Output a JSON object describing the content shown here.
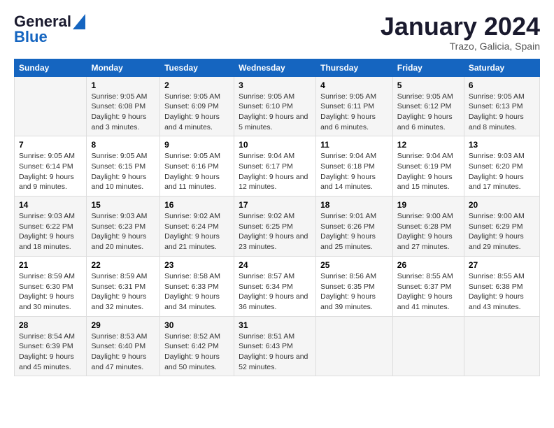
{
  "logo": {
    "line1": "General",
    "line2": "Blue"
  },
  "title": "January 2024",
  "subtitle": "Trazo, Galicia, Spain",
  "days_of_week": [
    "Sunday",
    "Monday",
    "Tuesday",
    "Wednesday",
    "Thursday",
    "Friday",
    "Saturday"
  ],
  "weeks": [
    [
      {
        "day": "",
        "sunrise": "",
        "sunset": "",
        "daylight": ""
      },
      {
        "day": "1",
        "sunrise": "9:05 AM",
        "sunset": "6:08 PM",
        "daylight": "9 hours and 3 minutes."
      },
      {
        "day": "2",
        "sunrise": "9:05 AM",
        "sunset": "6:09 PM",
        "daylight": "9 hours and 4 minutes."
      },
      {
        "day": "3",
        "sunrise": "9:05 AM",
        "sunset": "6:10 PM",
        "daylight": "9 hours and 5 minutes."
      },
      {
        "day": "4",
        "sunrise": "9:05 AM",
        "sunset": "6:11 PM",
        "daylight": "9 hours and 6 minutes."
      },
      {
        "day": "5",
        "sunrise": "9:05 AM",
        "sunset": "6:12 PM",
        "daylight": "9 hours and 6 minutes."
      },
      {
        "day": "6",
        "sunrise": "9:05 AM",
        "sunset": "6:13 PM",
        "daylight": "9 hours and 8 minutes."
      }
    ],
    [
      {
        "day": "7",
        "sunrise": "9:05 AM",
        "sunset": "6:14 PM",
        "daylight": "9 hours and 9 minutes."
      },
      {
        "day": "8",
        "sunrise": "9:05 AM",
        "sunset": "6:15 PM",
        "daylight": "9 hours and 10 minutes."
      },
      {
        "day": "9",
        "sunrise": "9:05 AM",
        "sunset": "6:16 PM",
        "daylight": "9 hours and 11 minutes."
      },
      {
        "day": "10",
        "sunrise": "9:04 AM",
        "sunset": "6:17 PM",
        "daylight": "9 hours and 12 minutes."
      },
      {
        "day": "11",
        "sunrise": "9:04 AM",
        "sunset": "6:18 PM",
        "daylight": "9 hours and 14 minutes."
      },
      {
        "day": "12",
        "sunrise": "9:04 AM",
        "sunset": "6:19 PM",
        "daylight": "9 hours and 15 minutes."
      },
      {
        "day": "13",
        "sunrise": "9:03 AM",
        "sunset": "6:20 PM",
        "daylight": "9 hours and 17 minutes."
      }
    ],
    [
      {
        "day": "14",
        "sunrise": "9:03 AM",
        "sunset": "6:22 PM",
        "daylight": "9 hours and 18 minutes."
      },
      {
        "day": "15",
        "sunrise": "9:03 AM",
        "sunset": "6:23 PM",
        "daylight": "9 hours and 20 minutes."
      },
      {
        "day": "16",
        "sunrise": "9:02 AM",
        "sunset": "6:24 PM",
        "daylight": "9 hours and 21 minutes."
      },
      {
        "day": "17",
        "sunrise": "9:02 AM",
        "sunset": "6:25 PM",
        "daylight": "9 hours and 23 minutes."
      },
      {
        "day": "18",
        "sunrise": "9:01 AM",
        "sunset": "6:26 PM",
        "daylight": "9 hours and 25 minutes."
      },
      {
        "day": "19",
        "sunrise": "9:00 AM",
        "sunset": "6:28 PM",
        "daylight": "9 hours and 27 minutes."
      },
      {
        "day": "20",
        "sunrise": "9:00 AM",
        "sunset": "6:29 PM",
        "daylight": "9 hours and 29 minutes."
      }
    ],
    [
      {
        "day": "21",
        "sunrise": "8:59 AM",
        "sunset": "6:30 PM",
        "daylight": "9 hours and 30 minutes."
      },
      {
        "day": "22",
        "sunrise": "8:59 AM",
        "sunset": "6:31 PM",
        "daylight": "9 hours and 32 minutes."
      },
      {
        "day": "23",
        "sunrise": "8:58 AM",
        "sunset": "6:33 PM",
        "daylight": "9 hours and 34 minutes."
      },
      {
        "day": "24",
        "sunrise": "8:57 AM",
        "sunset": "6:34 PM",
        "daylight": "9 hours and 36 minutes."
      },
      {
        "day": "25",
        "sunrise": "8:56 AM",
        "sunset": "6:35 PM",
        "daylight": "9 hours and 39 minutes."
      },
      {
        "day": "26",
        "sunrise": "8:55 AM",
        "sunset": "6:37 PM",
        "daylight": "9 hours and 41 minutes."
      },
      {
        "day": "27",
        "sunrise": "8:55 AM",
        "sunset": "6:38 PM",
        "daylight": "9 hours and 43 minutes."
      }
    ],
    [
      {
        "day": "28",
        "sunrise": "8:54 AM",
        "sunset": "6:39 PM",
        "daylight": "9 hours and 45 minutes."
      },
      {
        "day": "29",
        "sunrise": "8:53 AM",
        "sunset": "6:40 PM",
        "daylight": "9 hours and 47 minutes."
      },
      {
        "day": "30",
        "sunrise": "8:52 AM",
        "sunset": "6:42 PM",
        "daylight": "9 hours and 50 minutes."
      },
      {
        "day": "31",
        "sunrise": "8:51 AM",
        "sunset": "6:43 PM",
        "daylight": "9 hours and 52 minutes."
      },
      {
        "day": "",
        "sunrise": "",
        "sunset": "",
        "daylight": ""
      },
      {
        "day": "",
        "sunrise": "",
        "sunset": "",
        "daylight": ""
      },
      {
        "day": "",
        "sunrise": "",
        "sunset": "",
        "daylight": ""
      }
    ]
  ]
}
